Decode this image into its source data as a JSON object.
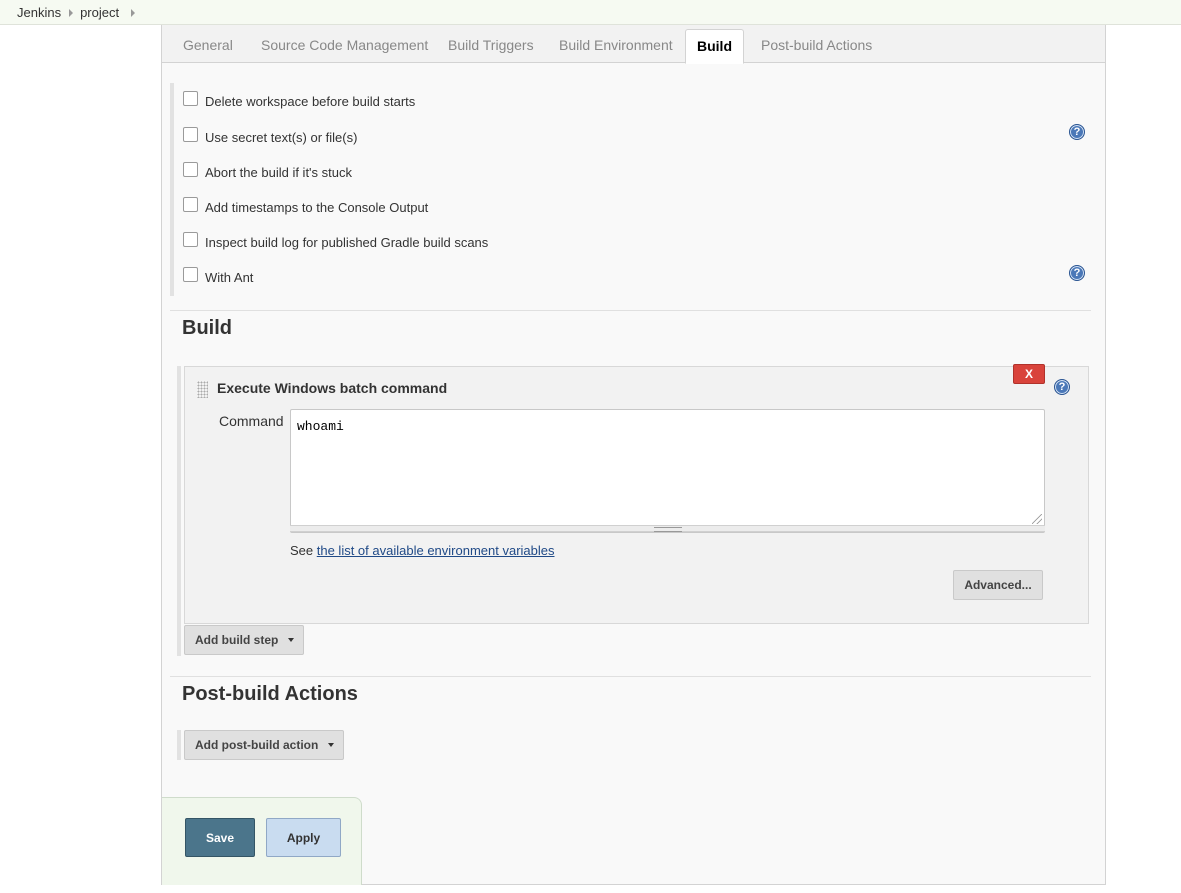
{
  "breadcrumb": {
    "items": [
      {
        "label": "Jenkins"
      },
      {
        "label": "project"
      }
    ]
  },
  "tabs": [
    {
      "label": "General"
    },
    {
      "label": "Source Code Management"
    },
    {
      "label": "Build Triggers"
    },
    {
      "label": "Build Environment"
    },
    {
      "label": "Build",
      "active": true
    },
    {
      "label": "Post-build Actions"
    }
  ],
  "build_environment": {
    "options": [
      {
        "label": "Delete workspace before build starts",
        "checked": false
      },
      {
        "label": "Use secret text(s) or file(s)",
        "checked": false
      },
      {
        "label": "Abort the build if it's stuck",
        "checked": false
      },
      {
        "label": "Add timestamps to the Console Output",
        "checked": false
      },
      {
        "label": "Inspect build log for published Gradle build scans",
        "checked": false
      },
      {
        "label": "With Ant",
        "checked": false
      }
    ],
    "help_glyph": "?"
  },
  "build_section": {
    "title": "Build",
    "step": {
      "title": "Execute Windows batch command",
      "delete_label": "X",
      "command_label": "Command",
      "command_value": "whoami",
      "env_prefix": "See ",
      "env_link": "the list of available environment variables",
      "advanced_label": "Advanced..."
    },
    "add_step_label": "Add build step"
  },
  "post_build": {
    "title": "Post-build Actions",
    "add_action_label": "Add post-build action"
  },
  "footer": {
    "save_label": "Save",
    "apply_label": "Apply"
  },
  "colors": {
    "save": "#4b758b",
    "apply": "#c9dcf0",
    "delete": "#d9433b",
    "help": "#4b78b8"
  }
}
